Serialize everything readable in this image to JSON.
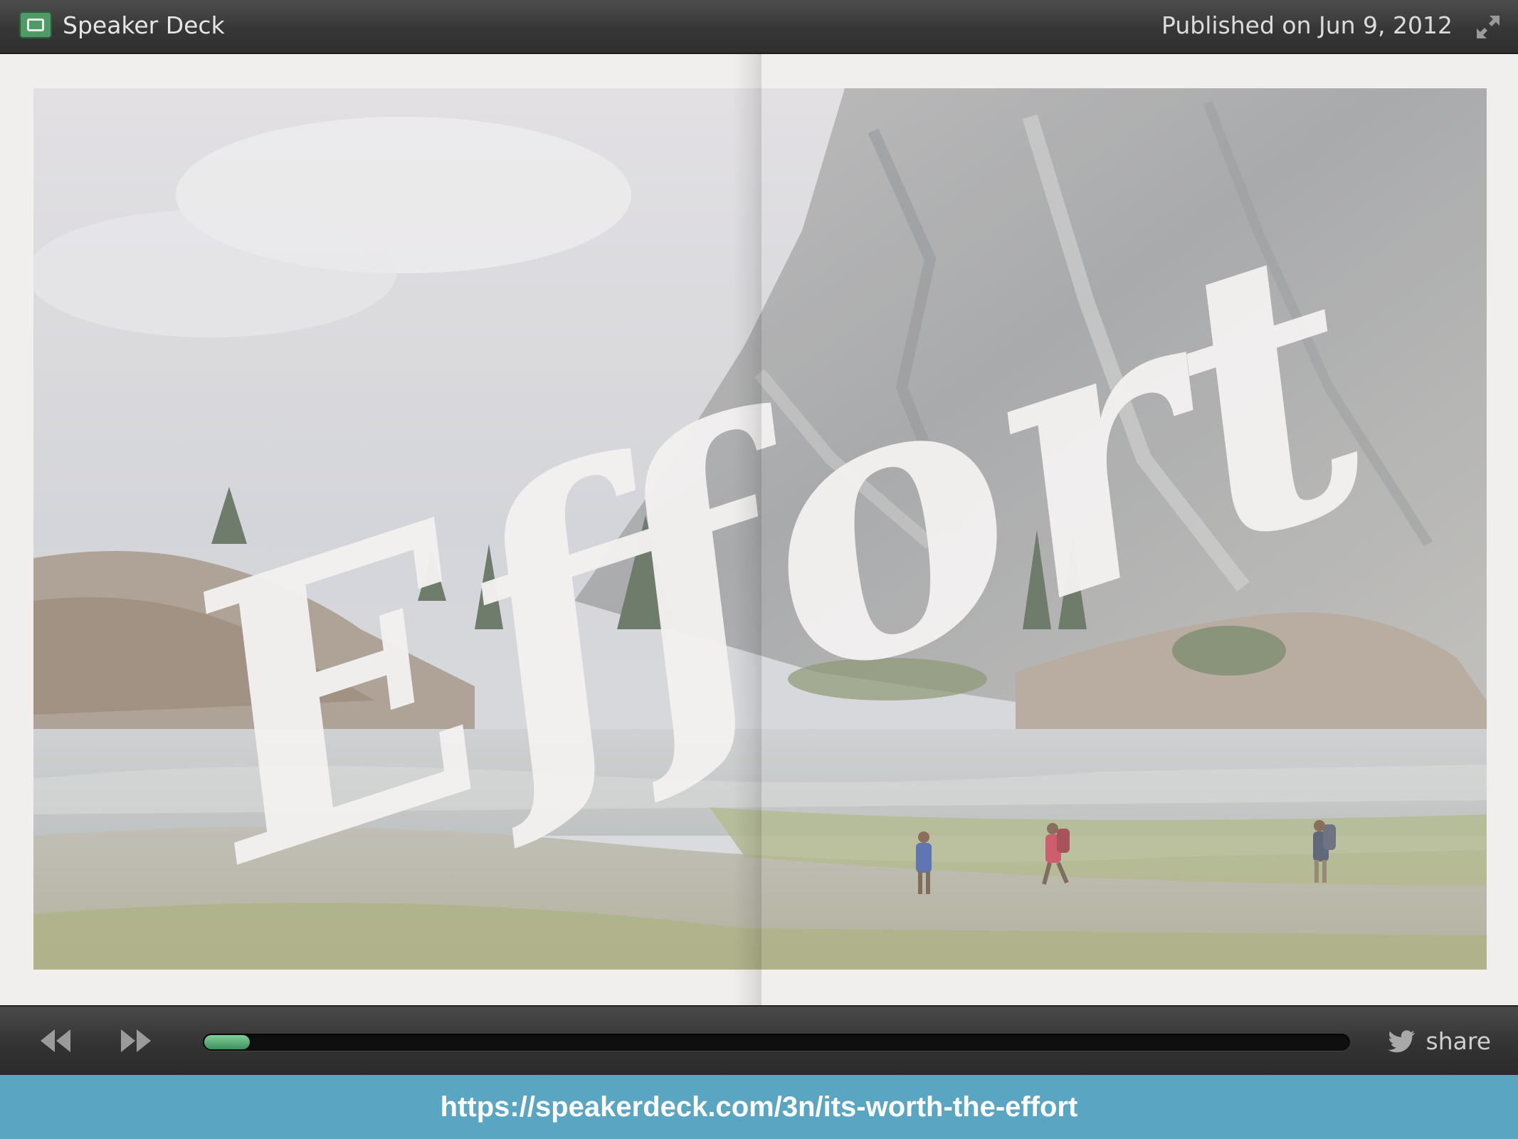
{
  "header": {
    "app_title": "Speaker Deck",
    "published": "Published on Jun 9, 2012",
    "icons": {
      "logo": "speakerdeck-logo-icon",
      "expand": "fullscreen-expand-icon"
    }
  },
  "slide": {
    "headline": "Effort",
    "description_icon": "mountain-lake-hikers-photo"
  },
  "controls": {
    "icons": {
      "previous": "rewind-icon",
      "next": "fast-forward-icon",
      "share": "twitter-bird-icon"
    },
    "progress_percent": 4,
    "share_label": "share"
  },
  "banner": {
    "url": "https://speakerdeck.com/3n/its-worth-the-effort"
  },
  "colors": {
    "accent_green": "#4f9a67",
    "banner_blue": "#5aa5c1",
    "bar_dark": "#333333",
    "slide_bg": "#f1efee"
  }
}
